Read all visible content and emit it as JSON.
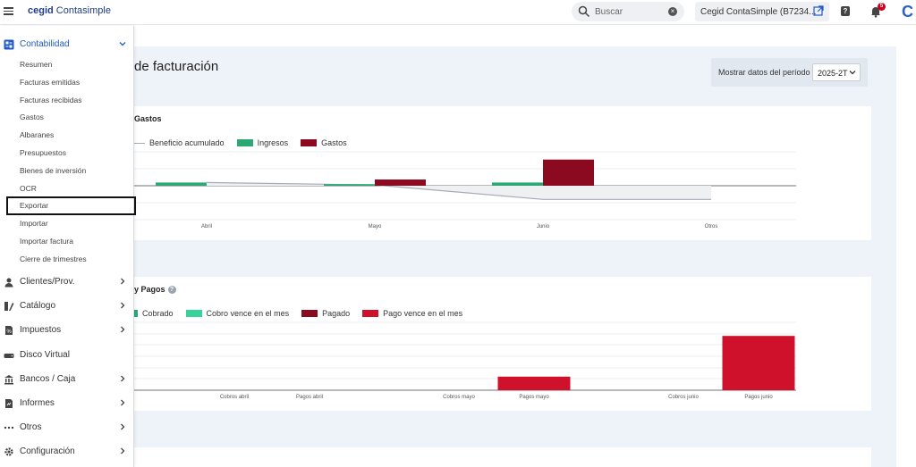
{
  "header": {
    "brand_bold": "cegid",
    "brand_rest": "Contasimple",
    "search_placeholder": "Buscar",
    "company_name": "Cegid ContaSimple (B7234...",
    "notifications_count": "5",
    "right_logo": "C"
  },
  "page": {
    "title": "de facturación",
    "period_label": "Mostrar datos del período",
    "period_value": "2025-2T"
  },
  "sidebar": {
    "contabilidad_label": "Contabilidad",
    "subitems": [
      "Resumen",
      "Facturas emitidas",
      "Facturas recibidas",
      "Gastos",
      "Albaranes",
      "Presupuestos",
      "Bienes de inversión",
      "OCR",
      "Exportar",
      "Importar",
      "Importar factura",
      "Cierre de trimestres"
    ],
    "sections": [
      {
        "label": "Clientes/Prov.",
        "icon": "users-icon",
        "has_arrow": true
      },
      {
        "label": "Catálogo",
        "icon": "catalog-icon",
        "has_arrow": true
      },
      {
        "label": "Impuestos",
        "icon": "tax-icon",
        "has_arrow": true
      },
      {
        "label": "Disco Virtual",
        "icon": "disk-icon",
        "has_arrow": false
      },
      {
        "label": "Bancos / Caja",
        "icon": "bank-icon",
        "has_arrow": true
      },
      {
        "label": "Informes",
        "icon": "report-icon",
        "has_arrow": true
      },
      {
        "label": "Otros",
        "icon": "dots-icon",
        "has_arrow": true
      },
      {
        "label": "Configuración",
        "icon": "gear-icon",
        "has_arrow": true
      }
    ]
  },
  "colors": {
    "ingresos": "#2aa876",
    "gastos": "#8b0a1f",
    "cobrado": "#2aa876",
    "cobro_vence": "#36d39a",
    "pagado": "#8b0a1f",
    "pago_vence": "#d0112b",
    "beneficio_line": "#a4acb8",
    "accent": "#1f5bc6"
  },
  "chart_data": [
    {
      "type": "bar",
      "title": "Gastos",
      "legend": [
        "Beneficio acumulado",
        "Ingresos",
        "Gastos"
      ],
      "categories": [
        "Abril",
        "Mayo",
        "Junio",
        "Otros"
      ],
      "series": [
        {
          "name": "Ingresos",
          "values": [
            4,
            2,
            4,
            0
          ]
        },
        {
          "name": "Gastos",
          "values": [
            0,
            5,
            21,
            0
          ]
        },
        {
          "name": "Beneficio acumulado",
          "values": [
            4,
            1,
            -17,
            -17
          ]
        }
      ],
      "ylim": [
        -27,
        27
      ],
      "grid": true
    },
    {
      "type": "bar",
      "title": "y Pagos",
      "legend": [
        "Cobrado",
        "Cobro vence en el mes",
        "Pagado",
        "Pago vence en el mes"
      ],
      "categories": [
        "Cobros abril",
        "Pagos abril",
        "Cobros mayo",
        "Pagos mayo",
        "Cobros junio",
        "Pagos junio"
      ],
      "series": [
        {
          "name": "Cobrado",
          "values": [
            0,
            0,
            0,
            0,
            0,
            0
          ]
        },
        {
          "name": "Cobro vence en el mes",
          "values": [
            0,
            0,
            0,
            0,
            0,
            0
          ]
        },
        {
          "name": "Pagado",
          "values": [
            0,
            0,
            0,
            0,
            0,
            0
          ]
        },
        {
          "name": "Pago vence en el mes",
          "values": [
            0,
            0,
            0,
            4,
            0,
            16
          ]
        }
      ],
      "ylim": [
        0,
        20
      ],
      "grid": true
    }
  ]
}
